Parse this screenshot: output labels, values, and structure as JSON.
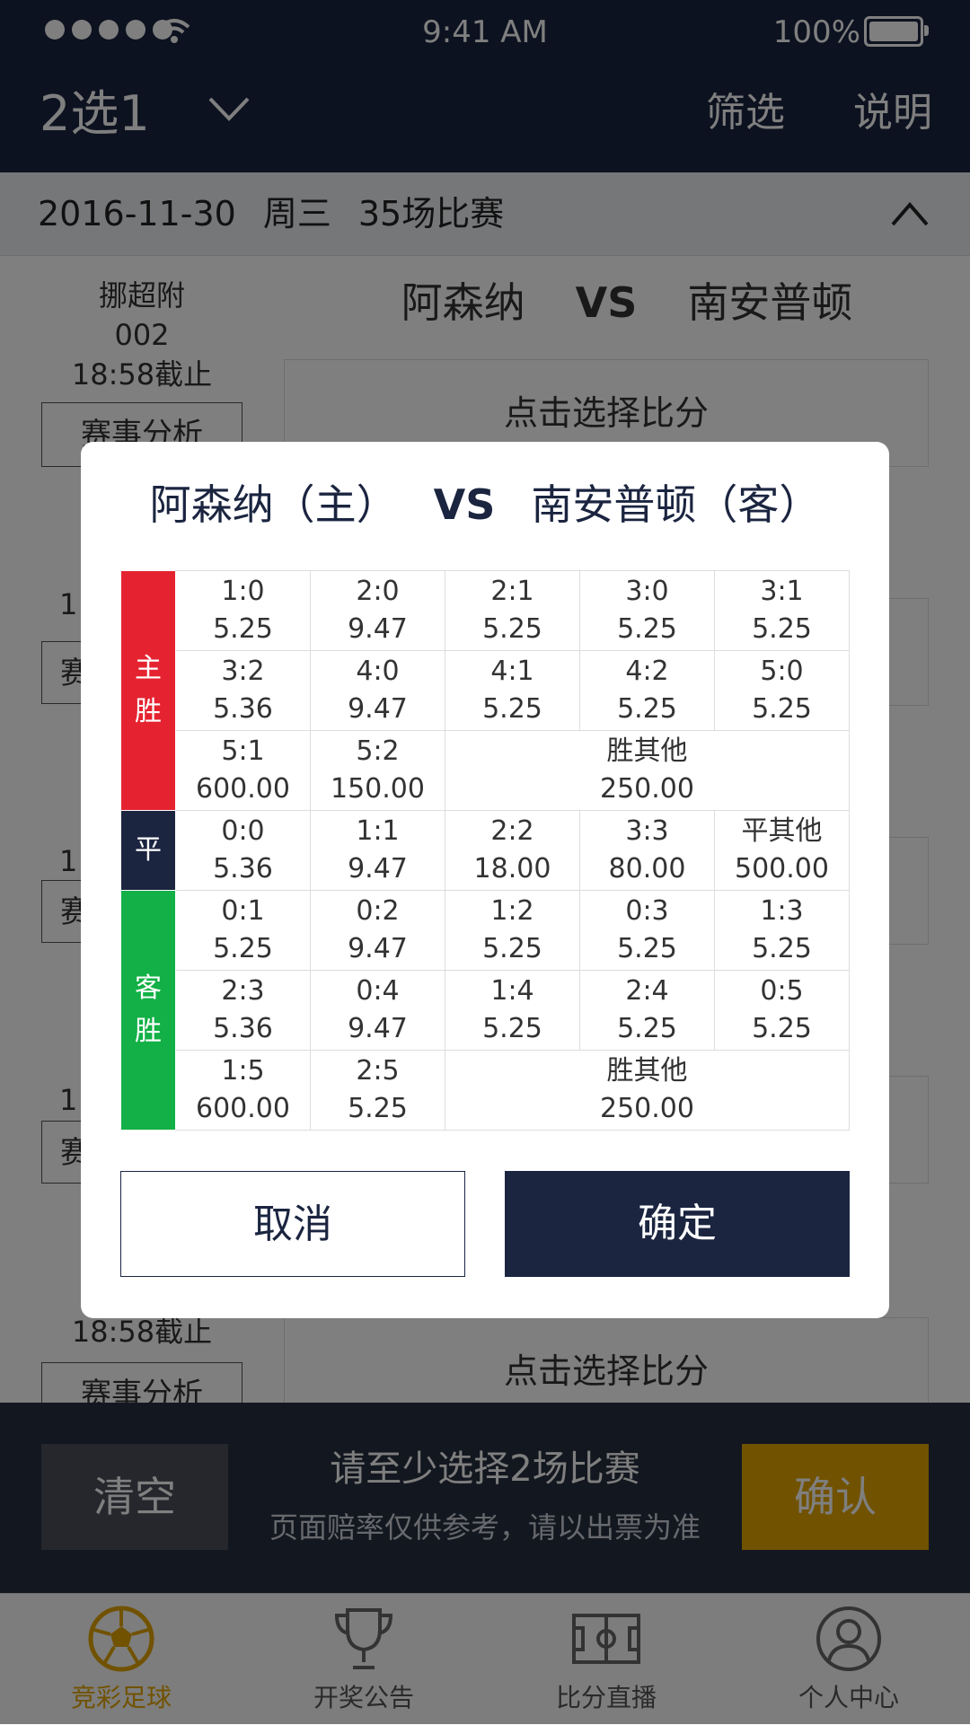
{
  "status": {
    "time": "9:41 AM",
    "battery": "100%"
  },
  "nav": {
    "title": "2选1",
    "filter": "筛选",
    "help": "说明"
  },
  "datebar": {
    "date": "2016-11-30",
    "weekday": "周三",
    "count": "35场比赛"
  },
  "match1": {
    "league": "挪超附",
    "number": "002",
    "deadline": "18:58截止",
    "home": "阿森纳",
    "vs": "VS",
    "away": "南安普顿",
    "analysis": "赛事分析",
    "pick": "点击选择比分"
  },
  "match_last": {
    "deadline": "18:58截止",
    "analysis": "赛事分析",
    "pick": "点击选择比分"
  },
  "stubs": [
    "1",
    "赛",
    "1",
    "赛",
    "1",
    "赛"
  ],
  "actionbar": {
    "clear": "清空",
    "hint": "请至少选择2场比赛",
    "note": "页面赔率仅供参考，请以出票为准",
    "confirm": "确认"
  },
  "tabs": [
    {
      "label": "竞彩足球",
      "icon": "football-icon"
    },
    {
      "label": "开奖公告",
      "icon": "trophy-icon"
    },
    {
      "label": "比分直播",
      "icon": "pitch-icon"
    },
    {
      "label": "个人中心",
      "icon": "user-icon"
    }
  ],
  "modal": {
    "home": "阿森纳（主）",
    "vs": "VS",
    "away": "南安普顿（客）",
    "groups": {
      "win": {
        "label": [
          "主",
          "胜"
        ]
      },
      "draw": {
        "label": [
          "平"
        ]
      },
      "lose": {
        "label": [
          "客",
          "胜"
        ]
      }
    },
    "win_rows": [
      [
        {
          "k": "1:0",
          "v": "5.25"
        },
        {
          "k": "2:0",
          "v": "9.47"
        },
        {
          "k": "2:1",
          "v": "5.25"
        },
        {
          "k": "3:0",
          "v": "5.25"
        },
        {
          "k": "3:1",
          "v": "5.25"
        }
      ],
      [
        {
          "k": "3:2",
          "v": "5.36"
        },
        {
          "k": "4:0",
          "v": "9.47"
        },
        {
          "k": "4:1",
          "v": "5.25"
        },
        {
          "k": "4:2",
          "v": "5.25"
        },
        {
          "k": "5:0",
          "v": "5.25"
        }
      ],
      [
        {
          "k": "5:1",
          "v": "600.00"
        },
        {
          "k": "5:2",
          "v": "150.00"
        },
        {
          "k": "胜其他",
          "v": "250.00"
        }
      ]
    ],
    "draw_row": [
      {
        "k": "0:0",
        "v": "5.36"
      },
      {
        "k": "1:1",
        "v": "9.47"
      },
      {
        "k": "2:2",
        "v": "18.00"
      },
      {
        "k": "3:3",
        "v": "80.00"
      },
      {
        "k": "平其他",
        "v": "500.00"
      }
    ],
    "lose_rows": [
      [
        {
          "k": "0:1",
          "v": "5.25"
        },
        {
          "k": "0:2",
          "v": "9.47"
        },
        {
          "k": "1:2",
          "v": "5.25"
        },
        {
          "k": "0:3",
          "v": "5.25"
        },
        {
          "k": "1:3",
          "v": "5.25"
        }
      ],
      [
        {
          "k": "2:3",
          "v": "5.36"
        },
        {
          "k": "0:4",
          "v": "9.47"
        },
        {
          "k": "1:4",
          "v": "5.25"
        },
        {
          "k": "2:4",
          "v": "5.25"
        },
        {
          "k": "0:5",
          "v": "5.25"
        }
      ],
      [
        {
          "k": "1:5",
          "v": "600.00"
        },
        {
          "k": "2:5",
          "v": "5.25"
        },
        {
          "k": "胜其他",
          "v": "250.00"
        }
      ]
    ],
    "cancel": "取消",
    "ok": "确定"
  },
  "colors": {
    "navy": "#1b2540",
    "red": "#e52330",
    "green": "#12b046",
    "gold": "#e3a400"
  }
}
